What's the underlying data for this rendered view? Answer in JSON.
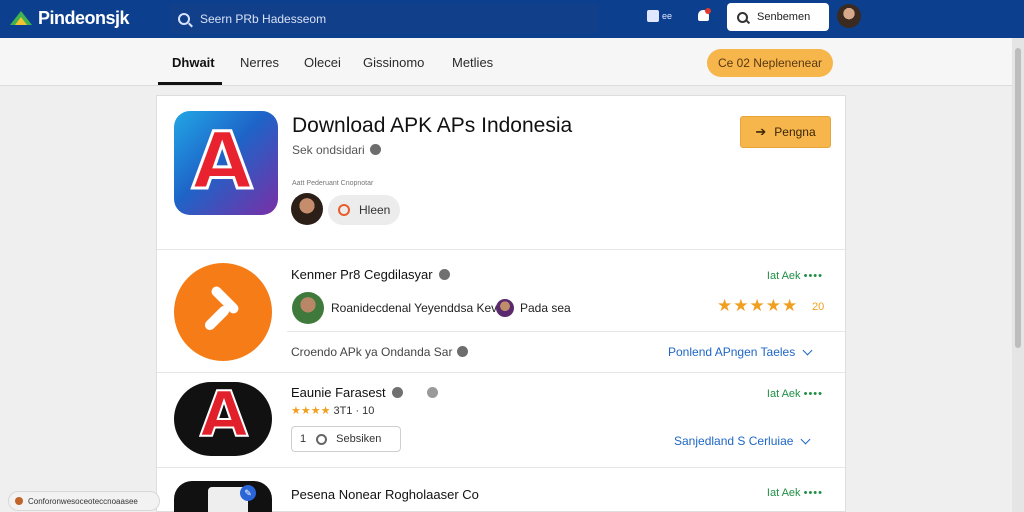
{
  "header": {
    "logo_text": "Pindeonsjk",
    "search_placeholder": "Seern PRb Hadesseom",
    "icon1_label": "ee",
    "search_button_label": "Senbemen"
  },
  "subnav": {
    "tabs": [
      "Dhwait",
      "Nerres",
      "Olecei",
      "Gissinomo",
      "Metlies"
    ],
    "active_tab": "Dhwait",
    "cta_label": "Ce 02 Neplenenear"
  },
  "hero": {
    "title": "Download APK APs Indonesia",
    "subtitle": "Sek ondsidari",
    "meta": "Aatt Pederuant Cnopnotar",
    "pill_label": "Hleen",
    "button_label": "Pengna"
  },
  "apps": [
    {
      "title": "Kenmer Pr8 Cegdilasyar",
      "right_label": "Iat Aek",
      "publisher": "Roanidecdenal Yeyenddsa Kev",
      "secondary": "Pada sea",
      "rating_text": "20",
      "subtitle": "Croendo APk ya Ondanda Sar",
      "link": "Ponlend APngen Taeles"
    },
    {
      "title": "Eaunie Farasest",
      "right_label": "Iat Aek",
      "rating_num": "3T1 · 10",
      "button_label": "Sebsiken",
      "link": "Sanjedland S Cerluiae"
    },
    {
      "title": "Pesena Nonear Rogholaaser",
      "title_suffix": "Co",
      "right_label": "Iat Aek"
    }
  ],
  "toast": {
    "text": "Conforonwesoceoteccnoaasee"
  },
  "colors": {
    "topbar": "#0d3f8f",
    "accent": "#f6b64c",
    "link": "#1e66c5",
    "green": "#1f8f45",
    "star": "#f0a020"
  }
}
